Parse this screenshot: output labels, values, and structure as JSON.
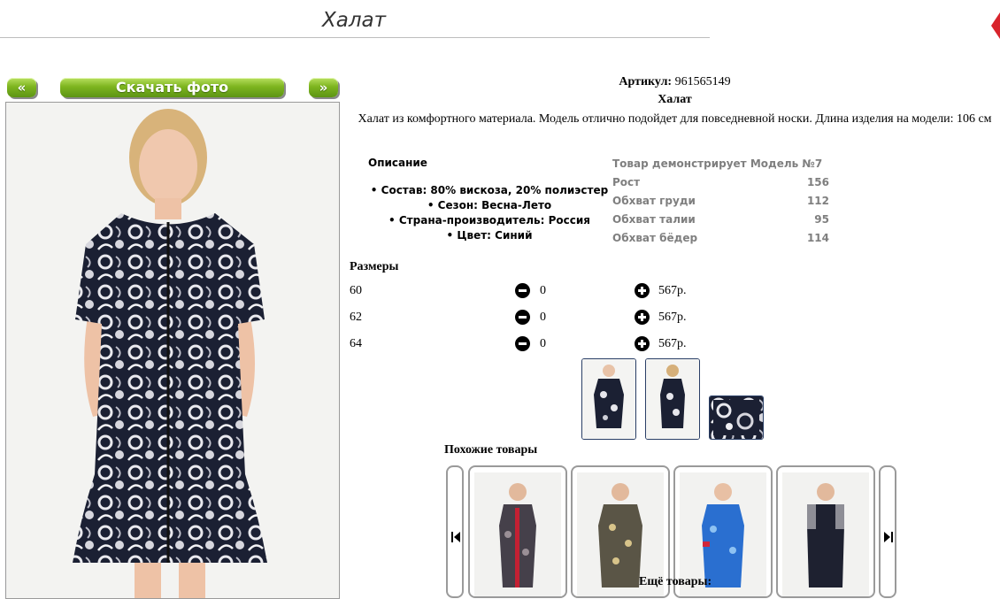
{
  "page": {
    "title": "Халат"
  },
  "photo_controls": {
    "prev_label": "«",
    "download_label": "Скачать фото",
    "next_label": "»"
  },
  "product": {
    "article_label": "Артикул:",
    "article_value": "961565149",
    "name": "Халат",
    "description": "Халат из комфортного материала. Модель отлично подойдет для повседневной носки. Длина изделия на модели: 106 см"
  },
  "specs": {
    "heading": "Описание",
    "items": [
      "• Состав: 80% вискоза, 20% полиэстер",
      "• Сезон: Весна-Лето",
      "• Страна-производитель: Россия",
      "• Цвет: Синий"
    ]
  },
  "model": {
    "heading": "Товар демонстрирует Модель №7",
    "rows": [
      {
        "label": "Рост",
        "value": "156"
      },
      {
        "label": "Обхват груди",
        "value": "112"
      },
      {
        "label": "Обхват талии",
        "value": "95"
      },
      {
        "label": "Обхват бёдер",
        "value": "114"
      }
    ]
  },
  "sizes": {
    "title": "Размеры",
    "rows": [
      {
        "size": "60",
        "qty": "0",
        "price": "567р."
      },
      {
        "size": "62",
        "qty": "0",
        "price": "567р."
      },
      {
        "size": "64",
        "qty": "0",
        "price": "567р."
      }
    ]
  },
  "similar": {
    "title": "Похожие товары",
    "more_label": "Ещё товары:"
  },
  "colors": {
    "button_green": "#7db51f",
    "thumb_border": "#2a3f66",
    "muted_text": "#7f7f7f",
    "dress_navy": "#1b2033",
    "corner_red": "#d8242c"
  },
  "icons": {
    "minus": "minus-circle-icon",
    "plus": "plus-circle-icon",
    "carousel_prev": "skip-back-icon",
    "carousel_next": "skip-forward-icon"
  }
}
